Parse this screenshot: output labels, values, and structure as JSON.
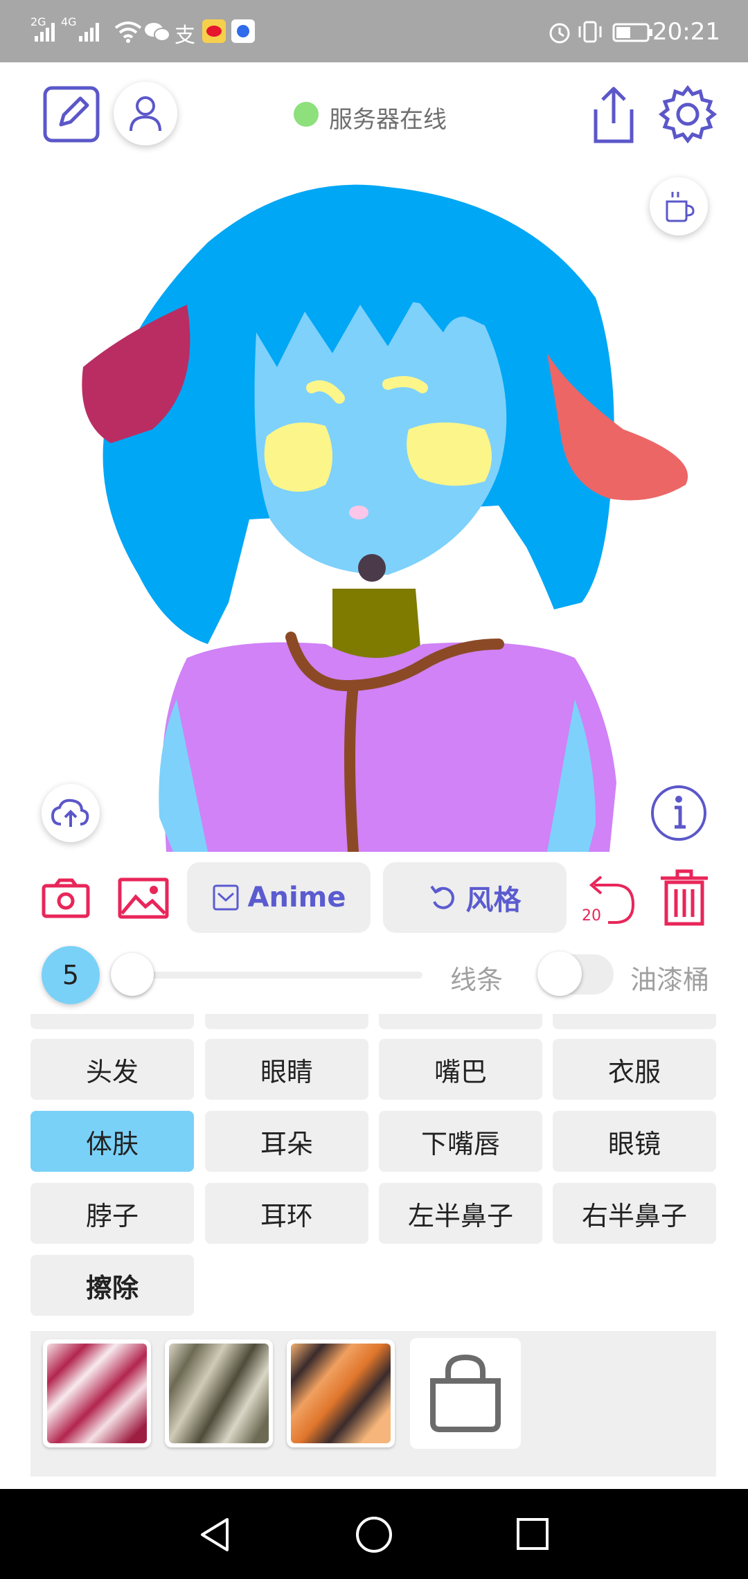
{
  "status_bar": {
    "signal_label_1": "2G",
    "signal_label_2": "4G",
    "time": "20:21"
  },
  "top_bar": {
    "server_status": "服务器在线",
    "colors": {
      "accent": "#5b57c9",
      "online": "#8de07c"
    }
  },
  "canvas": {
    "icons": [
      "coffee-icon",
      "cloud-upload-icon",
      "info-icon"
    ]
  },
  "toolbar": {
    "camera_icon": "camera-icon",
    "image_icon": "image-icon",
    "anime_label": "Anime",
    "style_label": "风格",
    "undo_count": "20",
    "colors": {
      "red": "#e8265a",
      "purple": "#5b5bd0"
    }
  },
  "brush": {
    "size": "5",
    "line_label": "线条",
    "bucket_label": "油漆桶",
    "bucket_enabled": false
  },
  "parts": {
    "items": [
      {
        "label": "头发"
      },
      {
        "label": "眼睛"
      },
      {
        "label": "嘴巴"
      },
      {
        "label": "衣服"
      },
      {
        "label": "体肤"
      },
      {
        "label": "耳朵"
      },
      {
        "label": "下嘴唇"
      },
      {
        "label": "眼镜"
      },
      {
        "label": "脖子"
      },
      {
        "label": "耳环"
      },
      {
        "label": "左半鼻子"
      },
      {
        "label": "右半鼻子"
      },
      {
        "label": "擦除"
      }
    ],
    "selected": "体肤"
  },
  "textures": [
    "crimson-pattern",
    "olive-pattern",
    "orange-pattern",
    "locked"
  ],
  "nav": [
    "back-icon",
    "home-icon",
    "recents-icon"
  ]
}
